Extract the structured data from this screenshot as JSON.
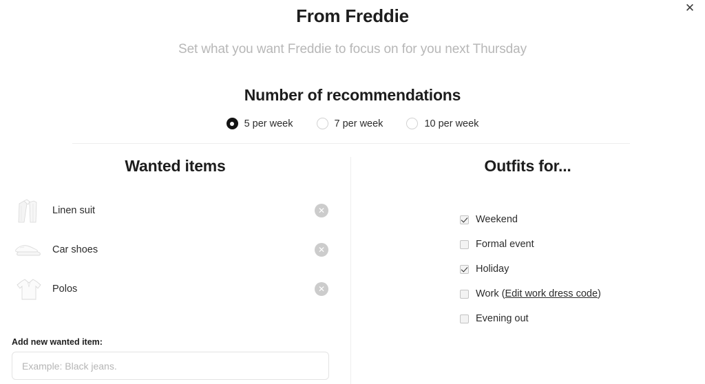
{
  "modal": {
    "title": "From Freddie",
    "subtitle": "Set what you want Freddie to focus on for you next Thursday",
    "close_label": "✕"
  },
  "recommendations": {
    "heading": "Number of recommendations",
    "options": [
      {
        "label": "5 per week",
        "selected": true
      },
      {
        "label": "7 per week",
        "selected": false
      },
      {
        "label": "10 per week",
        "selected": false
      }
    ]
  },
  "wanted_items": {
    "heading": "Wanted items",
    "remove_label": "✕",
    "items": [
      {
        "label": "Linen suit",
        "icon": "linen-suit-thumbnail"
      },
      {
        "label": "Car shoes",
        "icon": "car-shoes-thumbnail"
      },
      {
        "label": "Polos",
        "icon": "polo-shirt-thumbnail"
      }
    ],
    "add_label": "Add new wanted item:",
    "add_placeholder": "Example: Black jeans.",
    "add_value": ""
  },
  "outfits_for": {
    "heading": "Outfits for...",
    "options": [
      {
        "label": "Weekend",
        "checked": true,
        "link": null,
        "suffix": null
      },
      {
        "label": "Formal event",
        "checked": false,
        "link": null,
        "suffix": null
      },
      {
        "label": "Holiday",
        "checked": true,
        "link": null,
        "suffix": null
      },
      {
        "label": "Work (",
        "checked": false,
        "link": "Edit work dress code",
        "suffix": ")"
      },
      {
        "label": "Evening out",
        "checked": false,
        "link": null,
        "suffix": null
      }
    ]
  },
  "colors": {
    "accent": "#141414",
    "muted_text": "#b7b7b7",
    "divider": "#ededed",
    "remove_button": "#cccccc"
  }
}
